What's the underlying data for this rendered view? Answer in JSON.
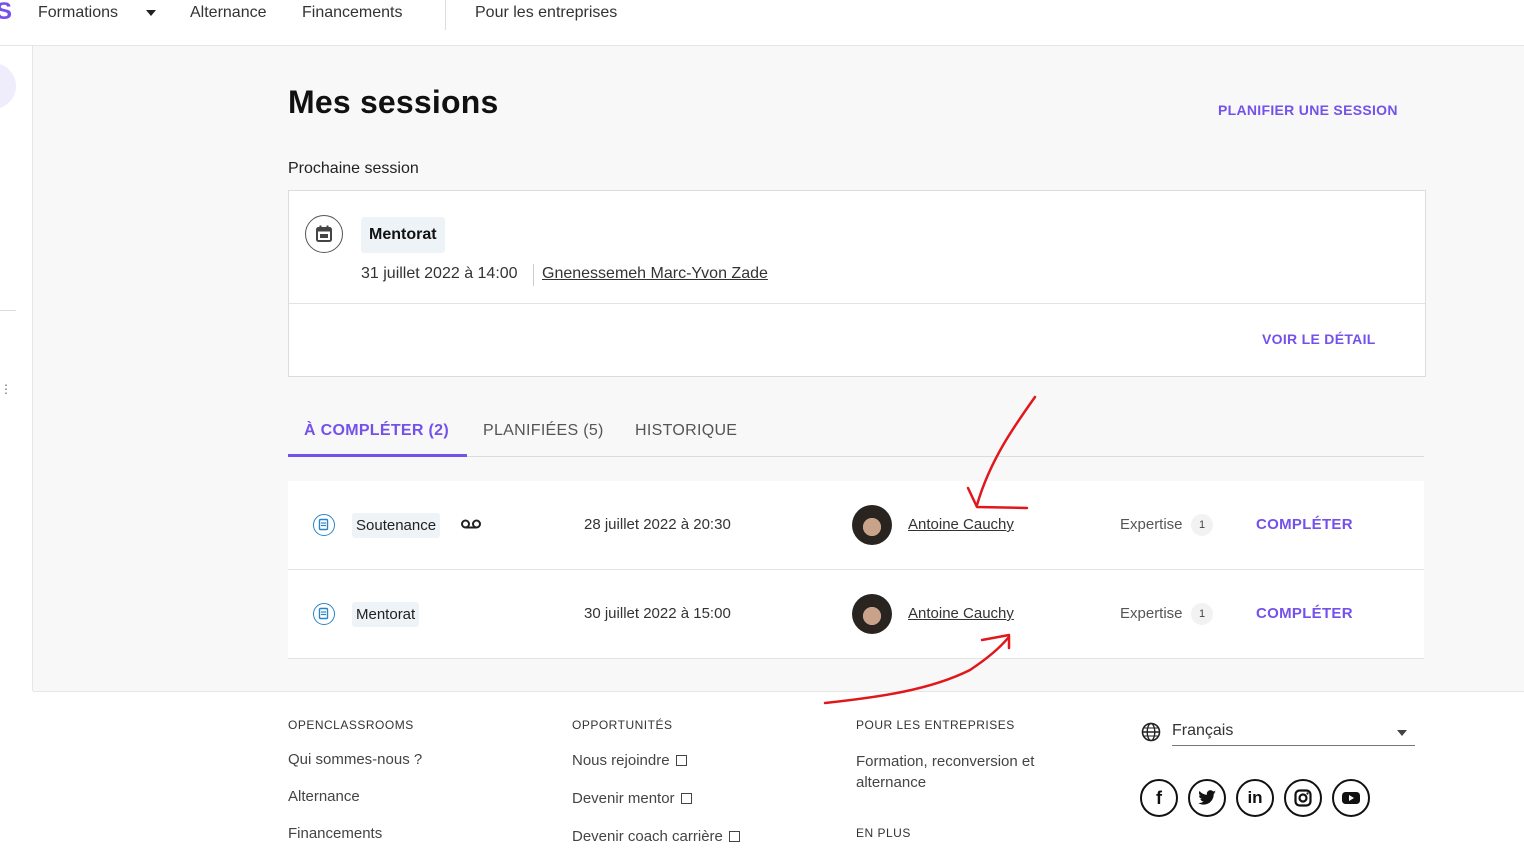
{
  "nav": {
    "logo_fragment": "S",
    "items": [
      {
        "label": "Formations"
      },
      {
        "label": "Alternance"
      },
      {
        "label": "Financements"
      },
      {
        "label": "Pour les entreprises"
      }
    ]
  },
  "page": {
    "title": "Mes sessions",
    "plan_button": "PLANIFIER UNE SESSION",
    "next_label": "Prochaine session"
  },
  "next_session": {
    "type": "Mentorat",
    "date": "31 juillet 2022 à 14:00",
    "person": "Gnenessemeh Marc-Yvon Zade",
    "detail_button": "VOIR LE DÉTAIL",
    "icon": "calendar-icon"
  },
  "tabs": [
    {
      "label": "À COMPLÉTER (2)",
      "active": true
    },
    {
      "label": "PLANIFIÉES (5)",
      "active": false
    },
    {
      "label": "HISTORIQUE",
      "active": false
    }
  ],
  "sessions": [
    {
      "type": "Soutenance",
      "has_recording": true,
      "date": "28 juillet 2022 à 20:30",
      "person": "Antoine Cauchy",
      "level_label": "Expertise",
      "level": "1",
      "action": "COMPLÉTER"
    },
    {
      "type": "Mentorat",
      "has_recording": false,
      "date": "30 juillet 2022 à 15:00",
      "person": "Antoine Cauchy",
      "level_label": "Expertise",
      "level": "1",
      "action": "COMPLÉTER"
    }
  ],
  "footer": {
    "col1": {
      "heading": "OPENCLASSROOMS",
      "links": [
        "Qui sommes-nous ?",
        "Alternance",
        "Financements"
      ]
    },
    "col2": {
      "heading": "OPPORTUNITÉS",
      "links": [
        "Nous rejoindre",
        "Devenir mentor",
        "Devenir coach carrière"
      ]
    },
    "col3": {
      "heading": "POUR LES ENTREPRISES",
      "link": "Formation, reconversion et alternance",
      "heading2": "EN PLUS"
    },
    "language": "Français",
    "social": [
      "facebook-icon",
      "twitter-icon",
      "linkedin-icon",
      "instagram-icon",
      "youtube-icon"
    ]
  },
  "colors": {
    "accent": "#7451eb",
    "annotation": "#e0181b",
    "session_icon": "#2b84c6"
  }
}
